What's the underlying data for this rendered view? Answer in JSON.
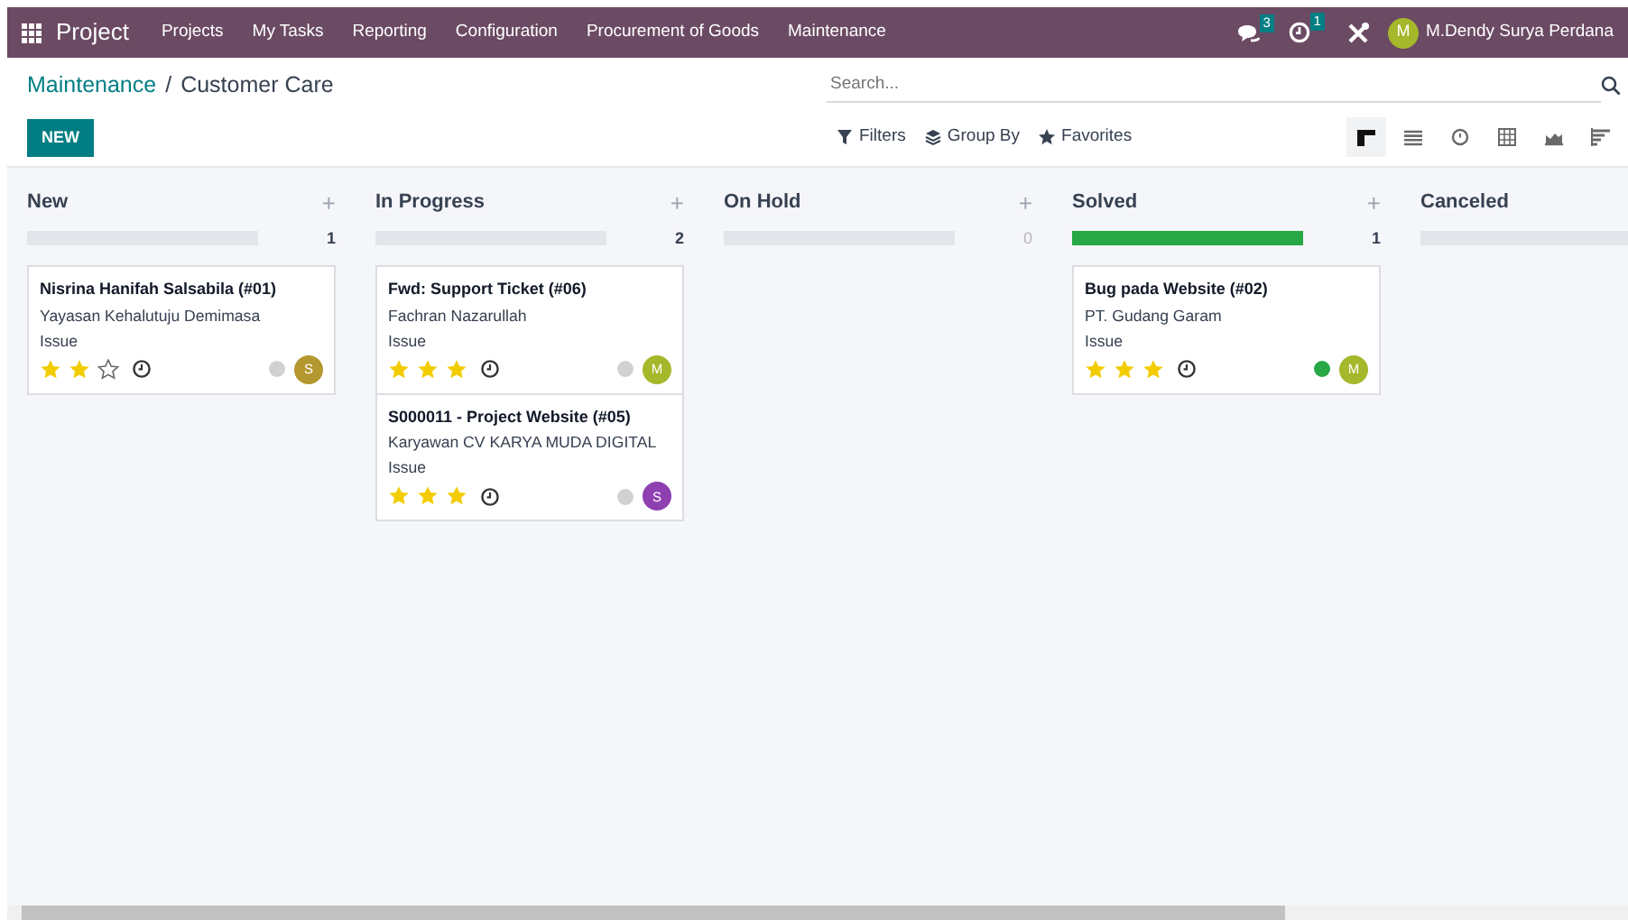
{
  "navbar": {
    "app": "Project",
    "menu": [
      "Projects",
      "My Tasks",
      "Reporting",
      "Configuration",
      "Procurement of Goods",
      "Maintenance"
    ],
    "messages_count": "3",
    "activities_count": "1",
    "user": {
      "initial": "M",
      "name": "M.Dendy Surya Perdana"
    }
  },
  "breadcrumb": {
    "items": [
      "Maintenance",
      "Customer Care"
    ],
    "separator": "/"
  },
  "new_button": "NEW",
  "search": {
    "placeholder": "Search..."
  },
  "filters": [
    {
      "kind": "filter",
      "label": "Filters"
    },
    {
      "kind": "group",
      "label": "Group By"
    },
    {
      "kind": "favorite",
      "label": "Favorites"
    }
  ],
  "views": [
    {
      "kind": "kanban",
      "selected": true
    },
    {
      "kind": "list",
      "selected": false
    },
    {
      "kind": "activity",
      "selected": false
    },
    {
      "kind": "pivot",
      "selected": false
    },
    {
      "kind": "graph",
      "selected": false
    },
    {
      "kind": "gantt",
      "selected": false
    }
  ],
  "columns": [
    {
      "name": "New",
      "add": "+",
      "count": "1",
      "level": 0,
      "cards": [
        {
          "title": "Nisrina Hanifah Salsabila (#01)",
          "customer": "Yayasan Kehalutuju Demimasa",
          "tag": "Issue",
          "stars": 2,
          "status": {
            "color": "#d1d1d1"
          },
          "avatar": {
            "initial": "S",
            "color": "#b5972f"
          }
        }
      ]
    },
    {
      "name": "In Progress",
      "add": "+",
      "count": "2",
      "level": 0,
      "cards": [
        {
          "title": "Fwd: Support Ticket (#06)",
          "customer": "Fachran Nazarullah",
          "tag": "Issue",
          "stars": 3,
          "status": {
            "color": "#d1d1d1"
          },
          "avatar": {
            "initial": "M",
            "color": "#a5b72a"
          }
        },
        {
          "title": "S000011 - Project Website (#05)",
          "customer": "Karyawan CV KARYA MUDA DIGITAL",
          "tag": "Issue",
          "stars": 3,
          "status": {
            "color": "#d1d1d1"
          },
          "avatar": {
            "initial": "S",
            "color": "#8e3fb0"
          }
        }
      ]
    },
    {
      "name": "On Hold",
      "add": "+",
      "count": "0",
      "level": 0
    },
    {
      "name": "Solved",
      "add": "+",
      "count": "1",
      "level": 1,
      "cards": [
        {
          "title": "Bug pada Website (#02)",
          "customer": "PT. Gudang Garam",
          "tag": "Issue",
          "stars": 3,
          "status": {
            "color": "#28a745"
          },
          "avatar": {
            "initial": "M",
            "color": "#a5b72a"
          }
        }
      ]
    },
    {
      "name": "Canceled",
      "level": 0
    }
  ]
}
